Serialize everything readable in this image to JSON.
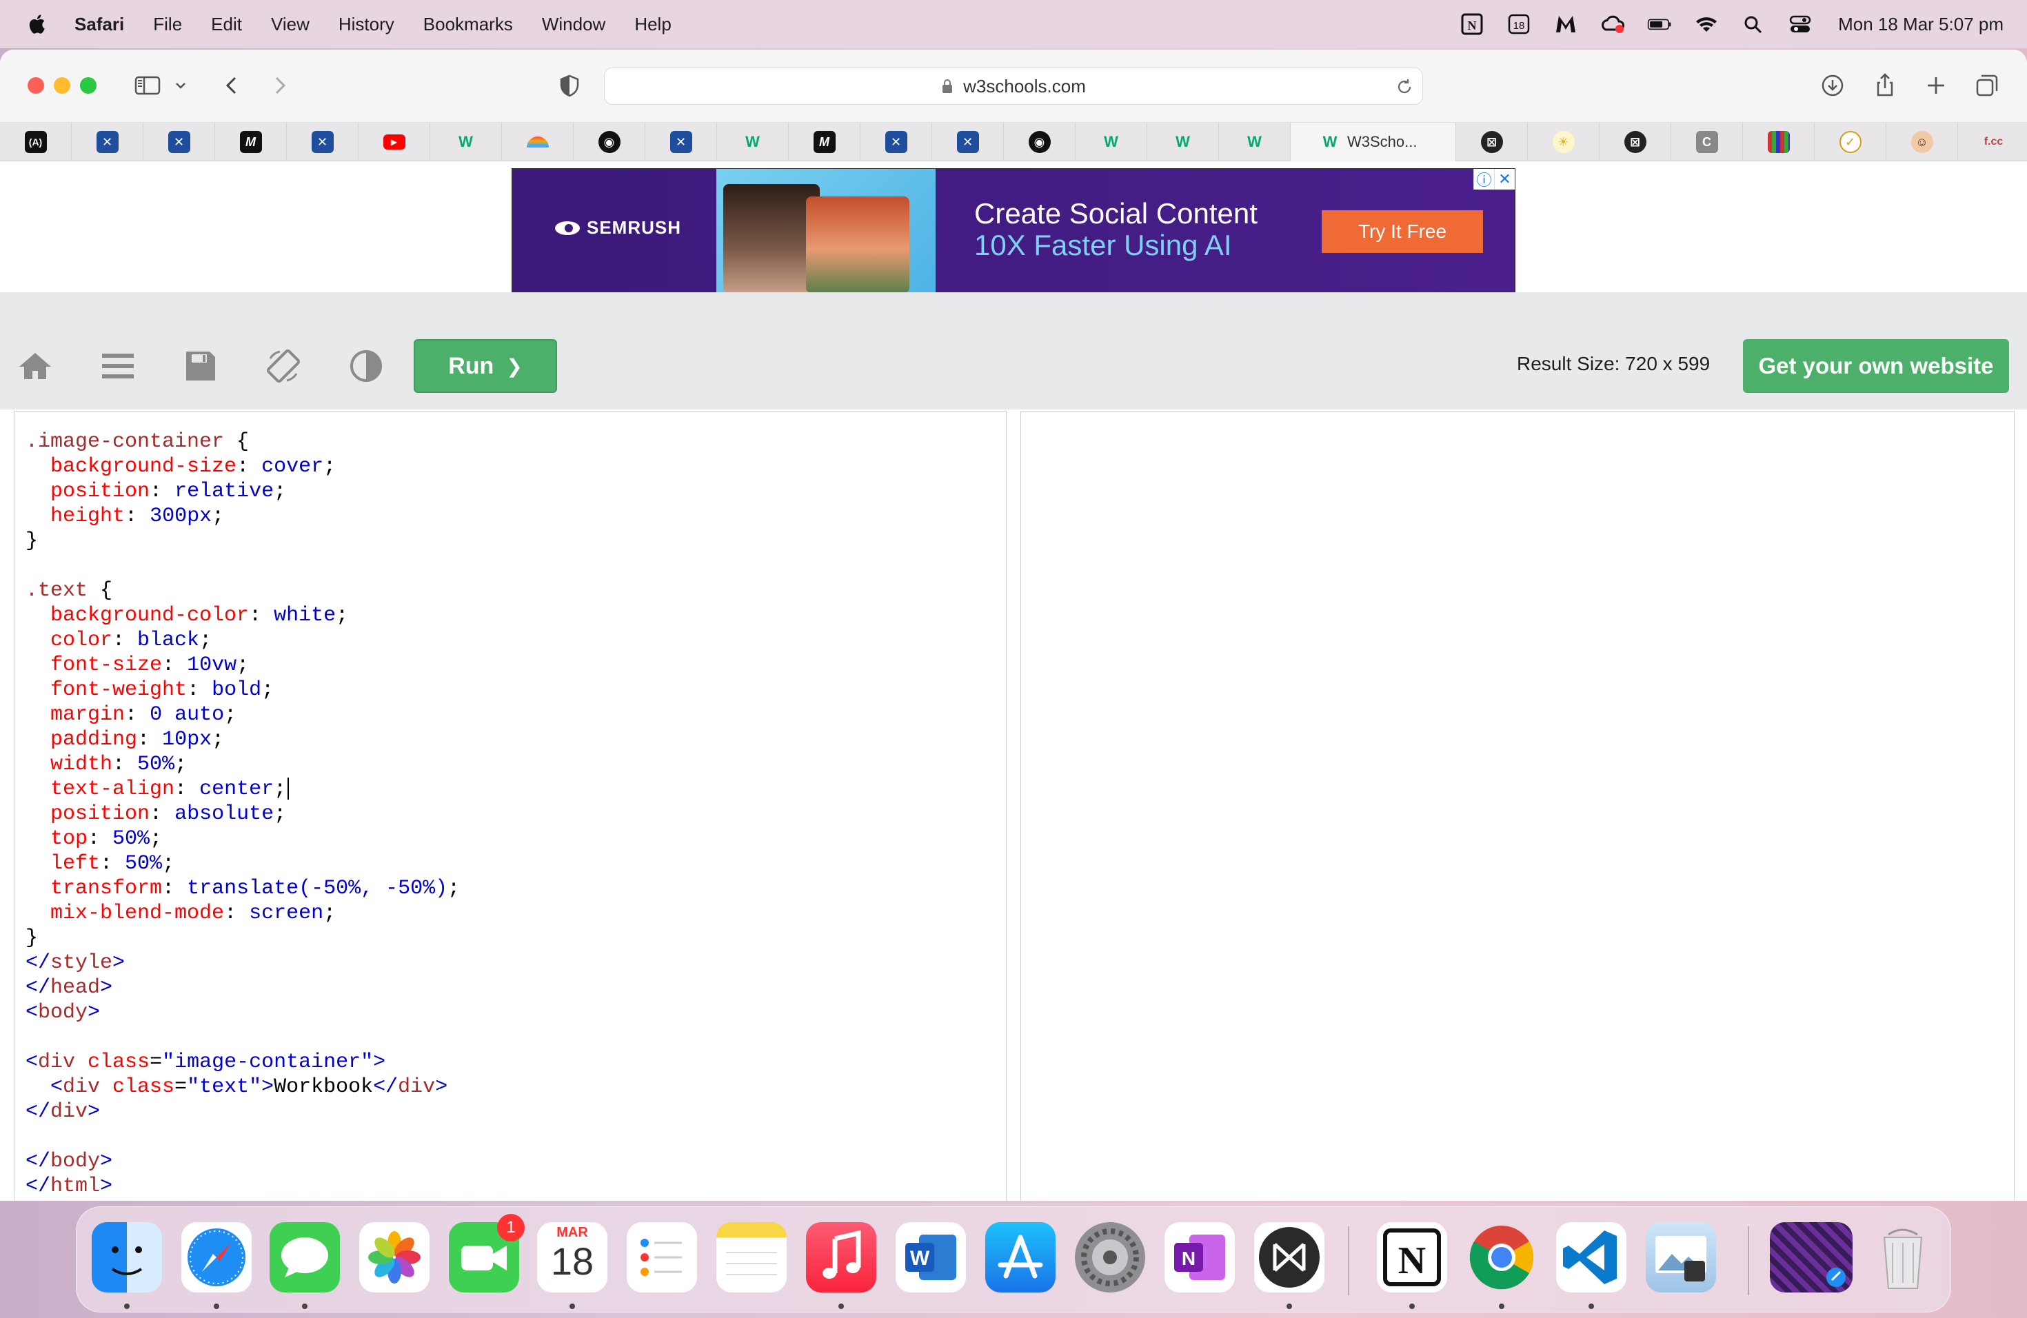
{
  "menubar": {
    "app": "Safari",
    "items": [
      "File",
      "Edit",
      "View",
      "History",
      "Bookmarks",
      "Window",
      "Help"
    ],
    "status_icons": [
      "notion-icon",
      "calendar-18-icon",
      "mail-m-icon",
      "creative-cloud-icon",
      "battery-icon",
      "wifi-icon",
      "search-icon",
      "control-center-icon"
    ],
    "calendar_badge": "18",
    "clock": "Mon 18 Mar  5:07 pm"
  },
  "browser": {
    "url": "w3schools.com",
    "active_tab_title": "W3Scho..."
  },
  "ad": {
    "brand": "SEMRUSH",
    "line1": "Create Social Content",
    "line2": "10X Faster Using AI",
    "cta": "Try It Free",
    "info": "ⓘ",
    "close": "✕"
  },
  "editor": {
    "run_label": "Run",
    "run_chevron": "❯",
    "result_size": "Result Size: 720 x 599",
    "own_site": "Get your own website"
  },
  "code_lines": [
    [
      [
        ".image-container",
        "sel"
      ],
      [
        " {",
        "p"
      ]
    ],
    [
      [
        "  ",
        "p"
      ],
      [
        "background-size",
        "prop"
      ],
      [
        ":",
        "p"
      ],
      [
        " cover",
        "val"
      ],
      [
        ";",
        "p"
      ]
    ],
    [
      [
        "  ",
        "p"
      ],
      [
        "position",
        "prop"
      ],
      [
        ":",
        "p"
      ],
      [
        " relative",
        "val"
      ],
      [
        ";",
        "p"
      ]
    ],
    [
      [
        "  ",
        "p"
      ],
      [
        "height",
        "prop"
      ],
      [
        ":",
        "p"
      ],
      [
        " 300px",
        "val"
      ],
      [
        ";",
        "p"
      ]
    ],
    [
      [
        "}",
        "p"
      ]
    ],
    [],
    [
      [
        ".text",
        "sel"
      ],
      [
        " {",
        "p"
      ]
    ],
    [
      [
        "  ",
        "p"
      ],
      [
        "background-color",
        "prop"
      ],
      [
        ":",
        "p"
      ],
      [
        " white",
        "val"
      ],
      [
        ";",
        "p"
      ]
    ],
    [
      [
        "  ",
        "p"
      ],
      [
        "color",
        "prop"
      ],
      [
        ":",
        "p"
      ],
      [
        " black",
        "val"
      ],
      [
        ";",
        "p"
      ]
    ],
    [
      [
        "  ",
        "p"
      ],
      [
        "font-size",
        "prop"
      ],
      [
        ":",
        "p"
      ],
      [
        " 10vw",
        "val"
      ],
      [
        ";",
        "p"
      ]
    ],
    [
      [
        "  ",
        "p"
      ],
      [
        "font-weight",
        "prop"
      ],
      [
        ":",
        "p"
      ],
      [
        " bold",
        "val"
      ],
      [
        ";",
        "p"
      ]
    ],
    [
      [
        "  ",
        "p"
      ],
      [
        "margin",
        "prop"
      ],
      [
        ":",
        "p"
      ],
      [
        " 0 auto",
        "val"
      ],
      [
        ";",
        "p"
      ]
    ],
    [
      [
        "  ",
        "p"
      ],
      [
        "padding",
        "prop"
      ],
      [
        ":",
        "p"
      ],
      [
        " 10px",
        "val"
      ],
      [
        ";",
        "p"
      ]
    ],
    [
      [
        "  ",
        "p"
      ],
      [
        "width",
        "prop"
      ],
      [
        ":",
        "p"
      ],
      [
        " 50%",
        "val"
      ],
      [
        ";",
        "p"
      ]
    ],
    [
      [
        "  ",
        "p"
      ],
      [
        "text-align",
        "prop"
      ],
      [
        ":",
        "p"
      ],
      [
        " center",
        "val"
      ],
      [
        ";",
        "p"
      ],
      [
        "",
        "caret"
      ]
    ],
    [
      [
        "  ",
        "p"
      ],
      [
        "position",
        "prop"
      ],
      [
        ":",
        "p"
      ],
      [
        " absolute",
        "val"
      ],
      [
        ";",
        "p"
      ]
    ],
    [
      [
        "  ",
        "p"
      ],
      [
        "top",
        "prop"
      ],
      [
        ":",
        "p"
      ],
      [
        " 50%",
        "val"
      ],
      [
        ";",
        "p"
      ]
    ],
    [
      [
        "  ",
        "p"
      ],
      [
        "left",
        "prop"
      ],
      [
        ":",
        "p"
      ],
      [
        " 50%",
        "val"
      ],
      [
        ";",
        "p"
      ]
    ],
    [
      [
        "  ",
        "p"
      ],
      [
        "transform",
        "prop"
      ],
      [
        ":",
        "p"
      ],
      [
        " translate(-50%, -50%)",
        "val"
      ],
      [
        ";",
        "p"
      ]
    ],
    [
      [
        "  ",
        "p"
      ],
      [
        "mix-blend-mode",
        "prop"
      ],
      [
        ":",
        "p"
      ],
      [
        " screen",
        "val"
      ],
      [
        ";",
        "p"
      ]
    ],
    [
      [
        "}",
        "p"
      ]
    ],
    [
      [
        "</",
        "tag"
      ],
      [
        "style",
        "tn"
      ],
      [
        ">",
        "tag"
      ]
    ],
    [
      [
        "</",
        "tag"
      ],
      [
        "head",
        "tn"
      ],
      [
        ">",
        "tag"
      ]
    ],
    [
      [
        "<",
        "tag"
      ],
      [
        "body",
        "tn"
      ],
      [
        ">",
        "tag"
      ]
    ],
    [],
    [
      [
        "<",
        "tag"
      ],
      [
        "div",
        "tn"
      ],
      [
        " class",
        "attr"
      ],
      [
        "=",
        "p"
      ],
      [
        "\"image-container\"",
        "str"
      ],
      [
        ">",
        "tag"
      ]
    ],
    [
      [
        "  <",
        "tag"
      ],
      [
        "div",
        "tn"
      ],
      [
        " class",
        "attr"
      ],
      [
        "=",
        "p"
      ],
      [
        "\"text\"",
        "str"
      ],
      [
        ">",
        "tag"
      ],
      [
        "Workbook",
        "txt"
      ],
      [
        "</",
        "tag"
      ],
      [
        "div",
        "tn"
      ],
      [
        ">",
        "tag"
      ]
    ],
    [
      [
        "</",
        "tag"
      ],
      [
        "div",
        "tn"
      ],
      [
        ">",
        "tag"
      ]
    ],
    [],
    [
      [
        "</",
        "tag"
      ],
      [
        "body",
        "tn"
      ],
      [
        ">",
        "tag"
      ]
    ],
    [
      [
        "</",
        "tag"
      ],
      [
        "html",
        "tn"
      ],
      [
        ">",
        "tag"
      ]
    ]
  ],
  "dock": {
    "facetime_badge": "1",
    "calendar_month": "MAR",
    "calendar_day": "18"
  },
  "colors": {
    "run_green": "#4caf6a",
    "ad_purple": "#3b1a7a",
    "cta_orange": "#f06a35",
    "code_selector": "#a52a2a",
    "code_property": "#ff0000",
    "code_value": "#0000cd"
  }
}
